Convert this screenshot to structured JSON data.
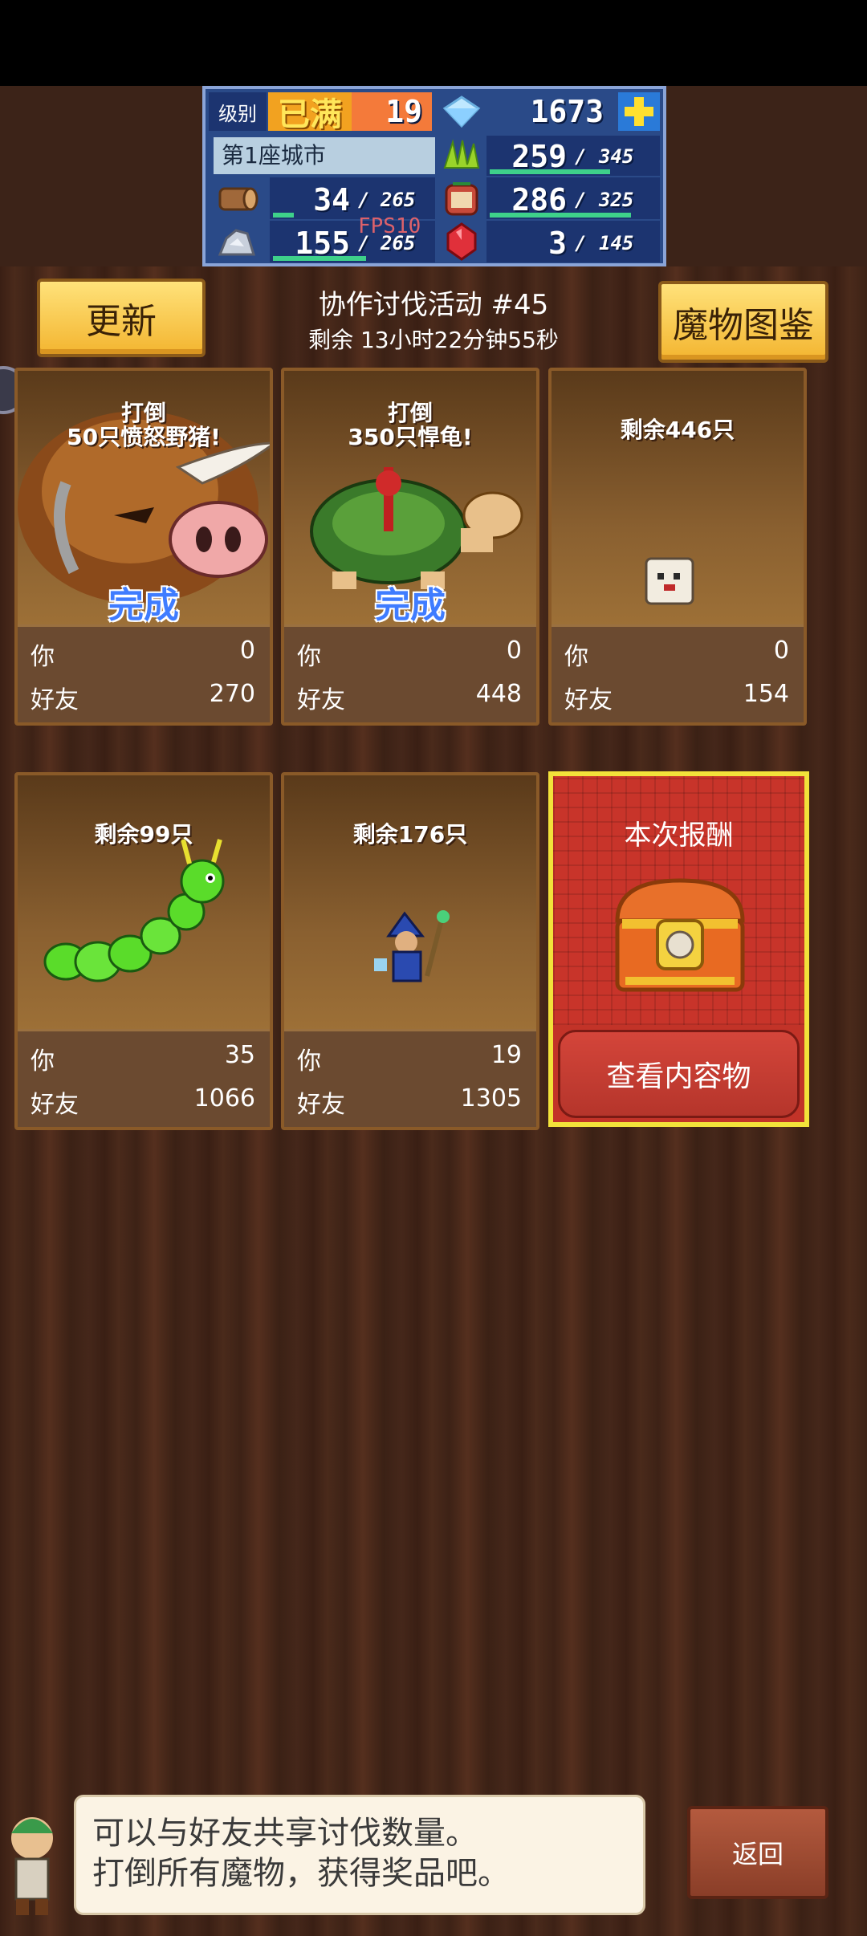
{
  "hud": {
    "level_label": "级别",
    "level_status": "已满",
    "level_value": "19",
    "gems": "1673",
    "city_name": "第1座城市",
    "grass_value": "259",
    "grass_max": "345",
    "wood_value": "34",
    "wood_max": "265",
    "food_value": "286",
    "food_max": "325",
    "ore_value": "155",
    "ore_max": "265",
    "fps": "FPS10",
    "ruby_value": "3",
    "ruby_max": "145",
    "icons": [
      "diamond-icon",
      "plus-icon",
      "grass-icon",
      "wood-icon",
      "food-bag-icon",
      "ore-icon",
      "ruby-icon"
    ]
  },
  "header": {
    "refresh_label": "更新",
    "event_title": "协作讨伐活动 #45",
    "remaining": "剩余 13小时22分钟55秒",
    "bestiary_label": "魔物图鉴"
  },
  "cards": [
    {
      "title": "打倒\n50只愤怒野猪!",
      "status": "完成",
      "you_label": "你",
      "you": "0",
      "friend_label": "好友",
      "friend": "270",
      "monster": "boar"
    },
    {
      "title": "打倒\n350只悍龟!",
      "status": "完成",
      "you_label": "你",
      "you": "0",
      "friend_label": "好友",
      "friend": "448",
      "monster": "turtle"
    },
    {
      "title": "剩余446只",
      "status": "",
      "you_label": "你",
      "you": "0",
      "friend_label": "好友",
      "friend": "154",
      "monster": "ghost"
    },
    {
      "title": "剩余99只",
      "status": "",
      "you_label": "你",
      "you": "35",
      "friend_label": "好友",
      "friend": "1066",
      "monster": "caterpillar"
    },
    {
      "title": "剩余176只",
      "status": "",
      "you_label": "你",
      "you": "19",
      "friend_label": "好友",
      "friend": "1305",
      "monster": "wizard"
    }
  ],
  "reward": {
    "title": "本次报酬",
    "button": "查看内容物"
  },
  "footer": {
    "message_line1": "可以与好友共享讨伐数量。",
    "message_line2": "打倒所有魔物，获得奖品吧。",
    "back_label": "返回"
  },
  "colors": {
    "accent_yellow": "#f3b530",
    "hud_blue": "#2a4a88",
    "reward_red": "#c23328",
    "done_blue": "#3f7cff"
  }
}
